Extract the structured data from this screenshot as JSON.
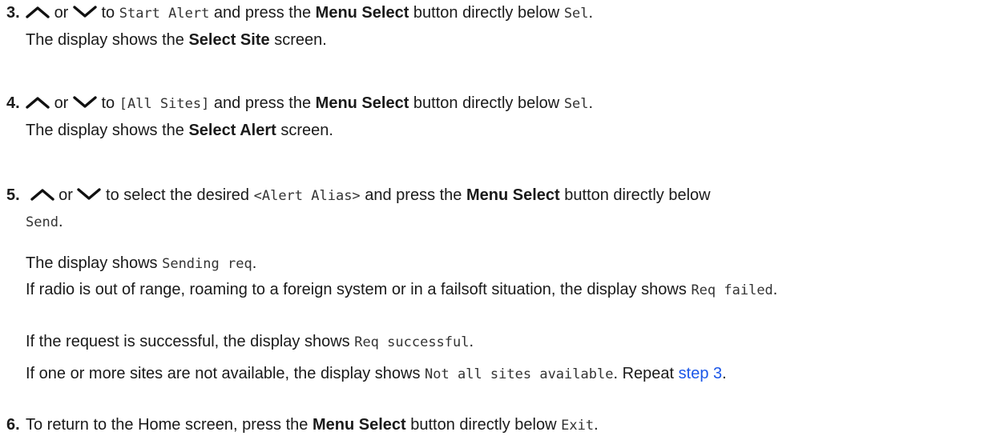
{
  "icons": {
    "up": "chevron-up-icon",
    "down": "chevron-down-icon"
  },
  "colors": {
    "text": "#1a1a1a",
    "link": "#1a56e8"
  },
  "step3": {
    "number": "3.",
    "or": "or",
    "to": "to",
    "target": "Start Alert",
    "press": "and press the",
    "button": "Menu Select",
    "directly": "button directly below",
    "key": "Sel",
    "period": ".",
    "result_prefix": "The display shows the",
    "result_screen": "Select Site",
    "result_suffix": "screen."
  },
  "step4": {
    "number": "4.",
    "or": "or",
    "to": "to",
    "target": "[All Sites]",
    "press": "and press the",
    "button": "Menu Select",
    "directly": "button directly below",
    "key": "Sel",
    "period": ".",
    "result_prefix": "The display shows the",
    "result_screen": "Select Alert",
    "result_suffix": "screen."
  },
  "step5": {
    "number": "5.",
    "or": "or",
    "to_select": "to select the desired",
    "target": "<Alert Alias>",
    "press": "and press the",
    "button": "Menu Select",
    "directly": "button directly below",
    "key": "Send",
    "period": ".",
    "sending_prefix": "The display shows",
    "sending_value": "Sending req",
    "failed_text": "If radio is out of range, roaming to a foreign system or in a failsoft situation, the display shows",
    "failed_value": "Req failed",
    "success_text": "If the request is successful, the display shows",
    "success_value": "Req successful",
    "partial_text": "If one or more sites are not available, the display shows",
    "partial_value": "Not all sites available",
    "repeat_text": "Repeat",
    "repeat_link": "step 3"
  },
  "step6": {
    "number": "6.",
    "text": "To return to the Home screen, press the",
    "button": "Menu Select",
    "directly": "button directly below",
    "key": "Exit",
    "period": "."
  }
}
